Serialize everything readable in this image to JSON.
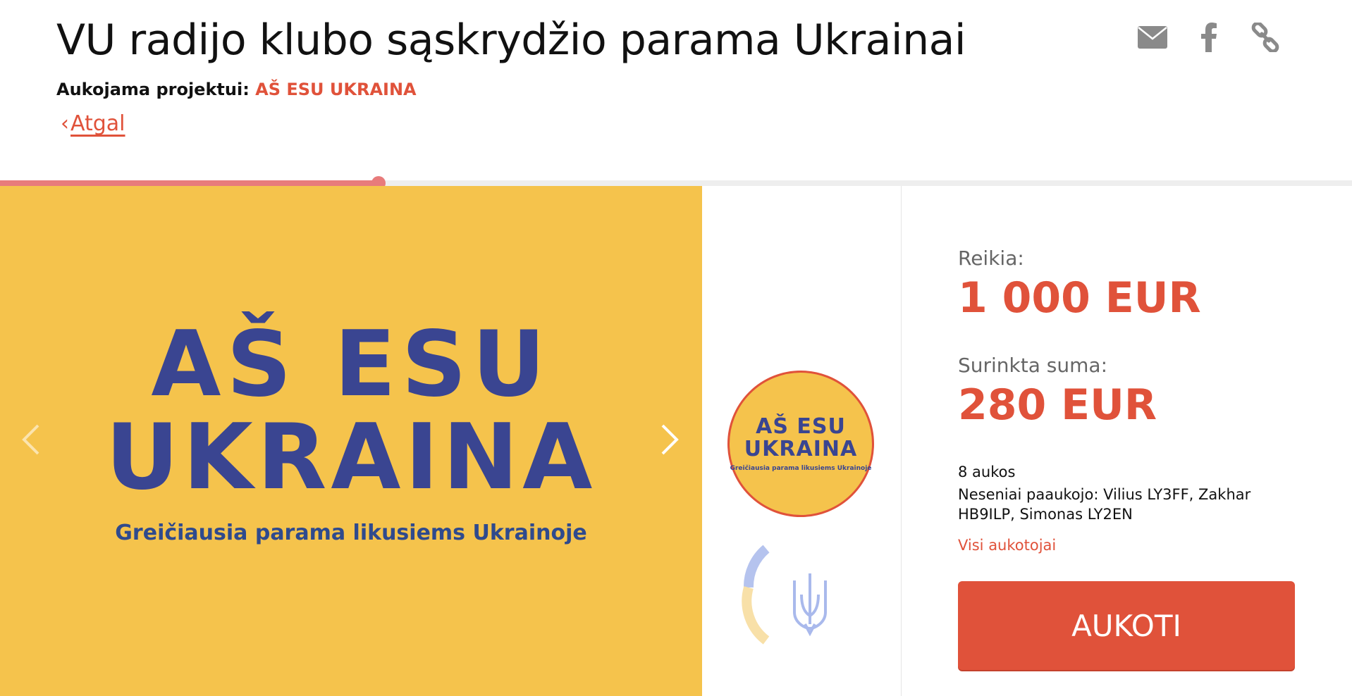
{
  "page": {
    "title": "VU radijo klubo sąskrydžio parama Ukrainai",
    "project_prefix": "Aukojama projektui:",
    "project_name": "AŠ ESU UKRAINA",
    "back_label": "Atgal",
    "back_chevron": "‹"
  },
  "share": {
    "email_icon": "envelope-icon",
    "facebook_icon": "facebook-icon",
    "link_icon": "link-icon"
  },
  "progress": {
    "fraction": 0.28,
    "color": "#e87b7b"
  },
  "hero": {
    "line1": "AŠ ESU",
    "line2": "UKRAINA",
    "subtitle": "Greičiausia parama likusiems Ukrainoje",
    "bg_color": "#f5c34c",
    "text_color": "#3a4591"
  },
  "thumbnail": {
    "line1": "AŠ ESU",
    "line2": "UKRAINA",
    "subtitle": "Greičiausia parama likusiems Ukrainoje"
  },
  "campaign": {
    "need_label": "Reikia:",
    "need_value": "1 000 EUR",
    "raised_label": "Surinkta suma:",
    "raised_value": "280 EUR",
    "donations_count": "8 aukos",
    "recent_donors": "Neseniai paaukojo: Vilius LY3FF, Zakhar HB9ILP, Simonas LY2EN",
    "all_donors_label": "Visi aukotojai",
    "donate_label": "AUKOTI",
    "accent_color": "#e0523a"
  }
}
